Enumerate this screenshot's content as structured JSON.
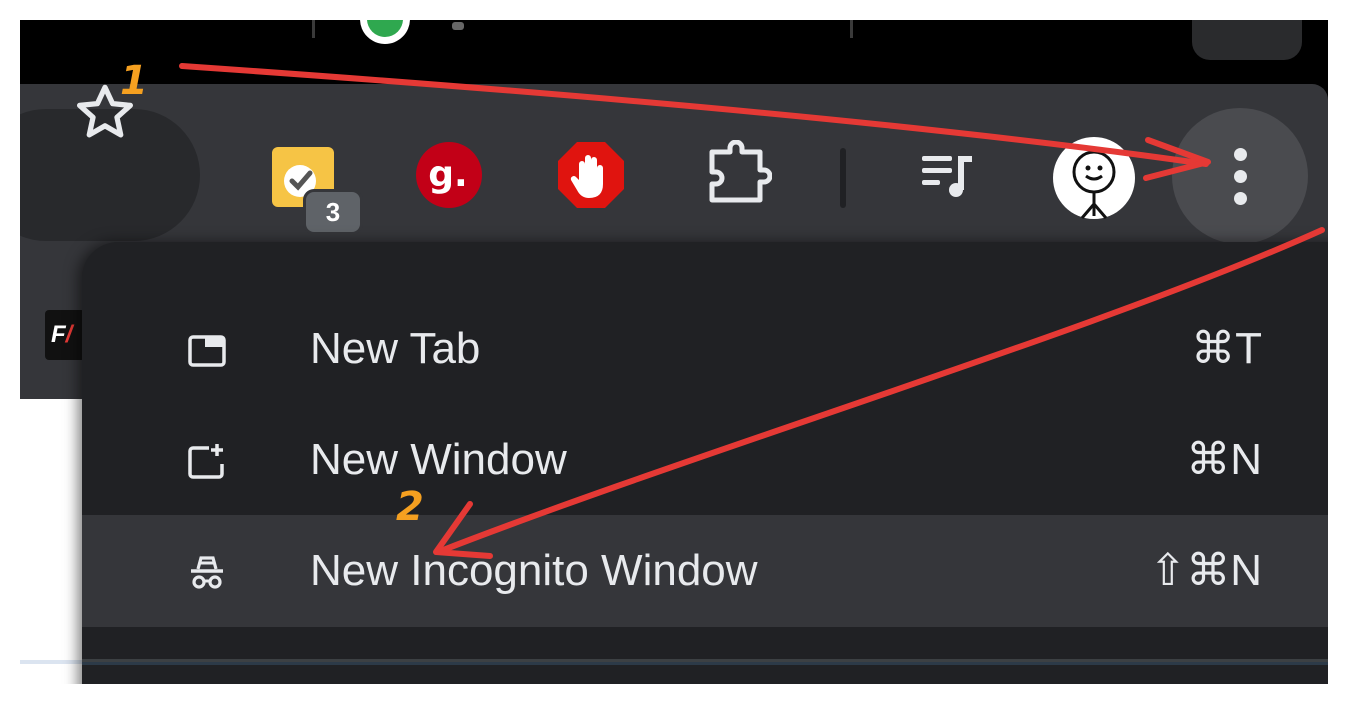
{
  "toolbar": {
    "bookmark_star_icon": "star-icon",
    "extensions": [
      {
        "name": "yellow-clock-extension-icon",
        "badge": "3"
      },
      {
        "name": "grammarly-extension-icon",
        "label": "g."
      },
      {
        "name": "adblock-hand-extension-icon"
      },
      {
        "name": "extensions-puzzle-icon"
      },
      {
        "name": "reading-list-icon"
      },
      {
        "name": "profile-avatar"
      }
    ],
    "menu_button_icon": "vertical-dots-icon"
  },
  "menu": {
    "items": [
      {
        "icon": "new-tab-icon",
        "label": "New Tab",
        "shortcut": "⌘T"
      },
      {
        "icon": "new-window-icon",
        "label": "New Window",
        "shortcut": "⌘N"
      },
      {
        "icon": "incognito-icon",
        "label": "New Incognito Window",
        "shortcut": "⇧⌘N"
      }
    ]
  },
  "annotations": {
    "step1": "1",
    "step2": "2",
    "arrow_color": "#e53935",
    "number_color": "#f5a020"
  },
  "colors": {
    "toolbar": "#35363a",
    "menu_bg": "#202124",
    "menu_highlight": "#35363a",
    "text": "#e8eaed"
  }
}
